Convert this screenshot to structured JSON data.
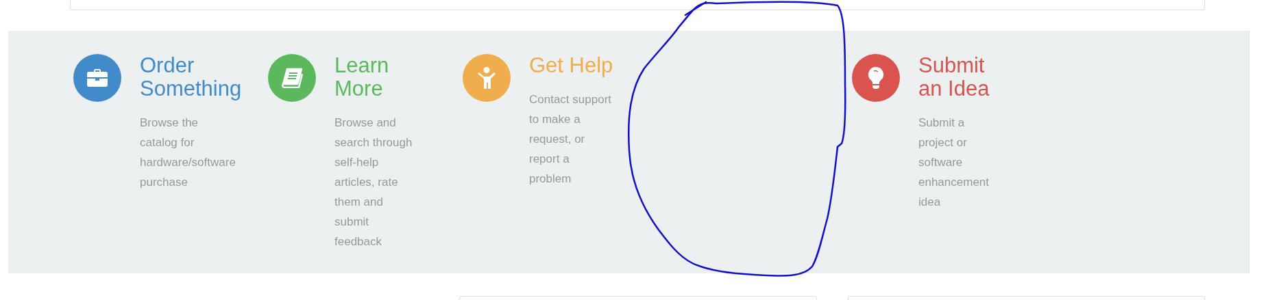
{
  "features": [
    {
      "kind": "item",
      "color": "#428bca",
      "title": [
        "Order",
        "Something"
      ],
      "description": [
        "Browse the",
        "catalog for",
        "hardware/software",
        "purchase"
      ]
    },
    {
      "kind": "item",
      "color": "#5cb85c",
      "title": [
        "Learn",
        "More"
      ],
      "description": [
        "Browse and",
        "search through",
        "self-help",
        "articles, rate",
        "them and",
        "submit",
        "feedback"
      ]
    },
    {
      "kind": "item",
      "color": "#f0ad4e",
      "title": [
        "Get Help"
      ],
      "description": [
        "Contact support",
        "to make a",
        "request, or",
        "report a",
        "problem"
      ]
    },
    {
      "kind": "empty"
    },
    {
      "kind": "item",
      "color": "#d9534f",
      "title": [
        "Submit",
        "an Idea"
      ],
      "description": [
        "Submit a",
        "project or",
        "software",
        "enhancement",
        "idea"
      ]
    }
  ]
}
